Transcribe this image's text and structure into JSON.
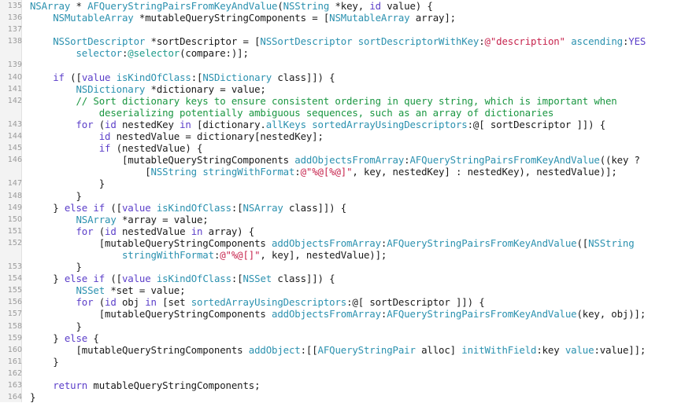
{
  "editor": {
    "name": "source-code-viewer",
    "language": "Objective-C",
    "background_color": "#ffffff",
    "gutter_color": "#f3f3f3",
    "line_number_color": "#9a9a9a",
    "first_line": 135,
    "last_line": 164,
    "colors": {
      "plain": "#1a1a1a",
      "type": "#2b91af",
      "function": "#2b91af",
      "keyword": "#5b3ec9",
      "string": "#c7254e",
      "comment": "#1a9641",
      "directive": "#1f9b8a"
    }
  },
  "lines": [
    {
      "number": "135",
      "tokens": [
        {
          "text": "NSArray",
          "kind": "type"
        },
        {
          "text": " * ",
          "kind": "plain"
        },
        {
          "text": "AFQueryStringPairsFromKeyAndValue",
          "kind": "func"
        },
        {
          "text": "(",
          "kind": "plain"
        },
        {
          "text": "NSString",
          "kind": "type"
        },
        {
          "text": " *key, ",
          "kind": "plain"
        },
        {
          "text": "id",
          "kind": "keyword"
        },
        {
          "text": " value) {",
          "kind": "plain"
        }
      ]
    },
    {
      "number": "136",
      "tokens": [
        {
          "text": "    ",
          "kind": "plain"
        },
        {
          "text": "NSMutableArray",
          "kind": "type"
        },
        {
          "text": " *mutableQueryStringComponents = [",
          "kind": "plain"
        },
        {
          "text": "NSMutableArray",
          "kind": "type"
        },
        {
          "text": " array];",
          "kind": "plain"
        }
      ]
    },
    {
      "number": "137",
      "tokens": []
    },
    {
      "number": "138",
      "tokens": [
        {
          "text": "    ",
          "kind": "plain"
        },
        {
          "text": "NSSortDescriptor",
          "kind": "type"
        },
        {
          "text": " *sortDescriptor = [",
          "kind": "plain"
        },
        {
          "text": "NSSortDescriptor",
          "kind": "type"
        },
        {
          "text": " ",
          "kind": "plain"
        },
        {
          "text": "sortDescriptorWithKey",
          "kind": "func"
        },
        {
          "text": ":",
          "kind": "plain"
        },
        {
          "text": "@\"description\"",
          "kind": "string"
        },
        {
          "text": " ",
          "kind": "plain"
        },
        {
          "text": "ascending",
          "kind": "func"
        },
        {
          "text": ":",
          "kind": "plain"
        },
        {
          "text": "YES",
          "kind": "keyword"
        }
      ]
    },
    {
      "number": "",
      "tokens": [
        {
          "text": "        ",
          "kind": "plain"
        },
        {
          "text": "selector",
          "kind": "func"
        },
        {
          "text": ":",
          "kind": "plain"
        },
        {
          "text": "@selector",
          "kind": "directive"
        },
        {
          "text": "(compare:)];",
          "kind": "plain"
        }
      ]
    },
    {
      "number": "139",
      "tokens": []
    },
    {
      "number": "140",
      "tokens": [
        {
          "text": "    ",
          "kind": "plain"
        },
        {
          "text": "if",
          "kind": "keyword"
        },
        {
          "text": " ([",
          "kind": "plain"
        },
        {
          "text": "value",
          "kind": "keyword"
        },
        {
          "text": " ",
          "kind": "plain"
        },
        {
          "text": "isKindOfClass",
          "kind": "func"
        },
        {
          "text": ":[",
          "kind": "plain"
        },
        {
          "text": "NSDictionary",
          "kind": "type"
        },
        {
          "text": " class]]) {",
          "kind": "plain"
        }
      ]
    },
    {
      "number": "141",
      "tokens": [
        {
          "text": "        ",
          "kind": "plain"
        },
        {
          "text": "NSDictionary",
          "kind": "type"
        },
        {
          "text": " *dictionary = value;",
          "kind": "plain"
        }
      ]
    },
    {
      "number": "142",
      "tokens": [
        {
          "text": "        ",
          "kind": "plain"
        },
        {
          "text": "// Sort dictionary keys to ensure consistent ordering in query string, which is important when",
          "kind": "comment"
        }
      ]
    },
    {
      "number": "",
      "tokens": [
        {
          "text": "            ",
          "kind": "plain"
        },
        {
          "text": "deserializing potentially ambiguous sequences, such as an array of dictionaries",
          "kind": "comment"
        }
      ]
    },
    {
      "number": "143",
      "tokens": [
        {
          "text": "        ",
          "kind": "plain"
        },
        {
          "text": "for",
          "kind": "keyword"
        },
        {
          "text": " (",
          "kind": "plain"
        },
        {
          "text": "id",
          "kind": "keyword"
        },
        {
          "text": " nestedKey ",
          "kind": "plain"
        },
        {
          "text": "in",
          "kind": "keyword"
        },
        {
          "text": " [dictionary.",
          "kind": "plain"
        },
        {
          "text": "allKeys",
          "kind": "prop"
        },
        {
          "text": " ",
          "kind": "plain"
        },
        {
          "text": "sortedArrayUsingDescriptors",
          "kind": "func"
        },
        {
          "text": ":@[ sortDescriptor ]]) {",
          "kind": "plain"
        }
      ]
    },
    {
      "number": "144",
      "tokens": [
        {
          "text": "            ",
          "kind": "plain"
        },
        {
          "text": "id",
          "kind": "keyword"
        },
        {
          "text": " nestedValue = dictionary[nestedKey];",
          "kind": "plain"
        }
      ]
    },
    {
      "number": "145",
      "tokens": [
        {
          "text": "            ",
          "kind": "plain"
        },
        {
          "text": "if",
          "kind": "keyword"
        },
        {
          "text": " (nestedValue) {",
          "kind": "plain"
        }
      ]
    },
    {
      "number": "146",
      "tokens": [
        {
          "text": "                [mutableQueryStringComponents ",
          "kind": "plain"
        },
        {
          "text": "addObjectsFromArray",
          "kind": "func"
        },
        {
          "text": ":",
          "kind": "plain"
        },
        {
          "text": "AFQueryStringPairsFromKeyAndValue",
          "kind": "func"
        },
        {
          "text": "((key ?",
          "kind": "plain"
        }
      ]
    },
    {
      "number": "",
      "tokens": [
        {
          "text": "                    [",
          "kind": "plain"
        },
        {
          "text": "NSString",
          "kind": "type"
        },
        {
          "text": " ",
          "kind": "plain"
        },
        {
          "text": "stringWithFormat",
          "kind": "func"
        },
        {
          "text": ":",
          "kind": "plain"
        },
        {
          "text": "@\"%@[%@]\"",
          "kind": "string"
        },
        {
          "text": ", key, nestedKey] : nestedKey), nestedValue)];",
          "kind": "plain"
        }
      ]
    },
    {
      "number": "147",
      "tokens": [
        {
          "text": "            }",
          "kind": "plain"
        }
      ]
    },
    {
      "number": "148",
      "tokens": [
        {
          "text": "        }",
          "kind": "plain"
        }
      ]
    },
    {
      "number": "149",
      "tokens": [
        {
          "text": "    } ",
          "kind": "plain"
        },
        {
          "text": "else",
          "kind": "keyword"
        },
        {
          "text": " ",
          "kind": "plain"
        },
        {
          "text": "if",
          "kind": "keyword"
        },
        {
          "text": " ([",
          "kind": "plain"
        },
        {
          "text": "value",
          "kind": "keyword"
        },
        {
          "text": " ",
          "kind": "plain"
        },
        {
          "text": "isKindOfClass",
          "kind": "func"
        },
        {
          "text": ":[",
          "kind": "plain"
        },
        {
          "text": "NSArray",
          "kind": "type"
        },
        {
          "text": " class]]) {",
          "kind": "plain"
        }
      ]
    },
    {
      "number": "150",
      "tokens": [
        {
          "text": "        ",
          "kind": "plain"
        },
        {
          "text": "NSArray",
          "kind": "type"
        },
        {
          "text": " *array = value;",
          "kind": "plain"
        }
      ]
    },
    {
      "number": "151",
      "tokens": [
        {
          "text": "        ",
          "kind": "plain"
        },
        {
          "text": "for",
          "kind": "keyword"
        },
        {
          "text": " (",
          "kind": "plain"
        },
        {
          "text": "id",
          "kind": "keyword"
        },
        {
          "text": " nestedValue ",
          "kind": "plain"
        },
        {
          "text": "in",
          "kind": "keyword"
        },
        {
          "text": " array) {",
          "kind": "plain"
        }
      ]
    },
    {
      "number": "152",
      "tokens": [
        {
          "text": "            [mutableQueryStringComponents ",
          "kind": "plain"
        },
        {
          "text": "addObjectsFromArray",
          "kind": "func"
        },
        {
          "text": ":",
          "kind": "plain"
        },
        {
          "text": "AFQueryStringPairsFromKeyAndValue",
          "kind": "func"
        },
        {
          "text": "([",
          "kind": "plain"
        },
        {
          "text": "NSString",
          "kind": "type"
        }
      ]
    },
    {
      "number": "",
      "tokens": [
        {
          "text": "                ",
          "kind": "plain"
        },
        {
          "text": "stringWithFormat",
          "kind": "func"
        },
        {
          "text": ":",
          "kind": "plain"
        },
        {
          "text": "@\"%@[]\"",
          "kind": "string"
        },
        {
          "text": ", key], nestedValue)];",
          "kind": "plain"
        }
      ]
    },
    {
      "number": "153",
      "tokens": [
        {
          "text": "        }",
          "kind": "plain"
        }
      ]
    },
    {
      "number": "154",
      "tokens": [
        {
          "text": "    } ",
          "kind": "plain"
        },
        {
          "text": "else",
          "kind": "keyword"
        },
        {
          "text": " ",
          "kind": "plain"
        },
        {
          "text": "if",
          "kind": "keyword"
        },
        {
          "text": " ([",
          "kind": "plain"
        },
        {
          "text": "value",
          "kind": "keyword"
        },
        {
          "text": " ",
          "kind": "plain"
        },
        {
          "text": "isKindOfClass",
          "kind": "func"
        },
        {
          "text": ":[",
          "kind": "plain"
        },
        {
          "text": "NSSet",
          "kind": "type"
        },
        {
          "text": " class]]) {",
          "kind": "plain"
        }
      ]
    },
    {
      "number": "155",
      "tokens": [
        {
          "text": "        ",
          "kind": "plain"
        },
        {
          "text": "NSSet",
          "kind": "type"
        },
        {
          "text": " *set = value;",
          "kind": "plain"
        }
      ]
    },
    {
      "number": "156",
      "tokens": [
        {
          "text": "        ",
          "kind": "plain"
        },
        {
          "text": "for",
          "kind": "keyword"
        },
        {
          "text": " (",
          "kind": "plain"
        },
        {
          "text": "id",
          "kind": "keyword"
        },
        {
          "text": " obj ",
          "kind": "plain"
        },
        {
          "text": "in",
          "kind": "keyword"
        },
        {
          "text": " [set ",
          "kind": "plain"
        },
        {
          "text": "sortedArrayUsingDescriptors",
          "kind": "func"
        },
        {
          "text": ":@[ sortDescriptor ]]) {",
          "kind": "plain"
        }
      ]
    },
    {
      "number": "157",
      "tokens": [
        {
          "text": "            [mutableQueryStringComponents ",
          "kind": "plain"
        },
        {
          "text": "addObjectsFromArray",
          "kind": "func"
        },
        {
          "text": ":",
          "kind": "plain"
        },
        {
          "text": "AFQueryStringPairsFromKeyAndValue",
          "kind": "func"
        },
        {
          "text": "(key, obj)];",
          "kind": "plain"
        }
      ]
    },
    {
      "number": "158",
      "tokens": [
        {
          "text": "        }",
          "kind": "plain"
        }
      ]
    },
    {
      "number": "159",
      "tokens": [
        {
          "text": "    } ",
          "kind": "plain"
        },
        {
          "text": "else",
          "kind": "keyword"
        },
        {
          "text": " {",
          "kind": "plain"
        }
      ]
    },
    {
      "number": "160",
      "tokens": [
        {
          "text": "        [mutableQueryStringComponents ",
          "kind": "plain"
        },
        {
          "text": "addObject",
          "kind": "func"
        },
        {
          "text": ":[[",
          "kind": "plain"
        },
        {
          "text": "AFQueryStringPair",
          "kind": "type"
        },
        {
          "text": " alloc] ",
          "kind": "plain"
        },
        {
          "text": "initWithField",
          "kind": "func"
        },
        {
          "text": ":key ",
          "kind": "plain"
        },
        {
          "text": "value",
          "kind": "func"
        },
        {
          "text": ":value]];",
          "kind": "plain"
        }
      ]
    },
    {
      "number": "161",
      "tokens": [
        {
          "text": "    }",
          "kind": "plain"
        }
      ]
    },
    {
      "number": "162",
      "tokens": []
    },
    {
      "number": "163",
      "tokens": [
        {
          "text": "    ",
          "kind": "plain"
        },
        {
          "text": "return",
          "kind": "keyword"
        },
        {
          "text": " mutableQueryStringComponents;",
          "kind": "plain"
        }
      ]
    },
    {
      "number": "164",
      "tokens": [
        {
          "text": "}",
          "kind": "plain"
        }
      ]
    }
  ]
}
